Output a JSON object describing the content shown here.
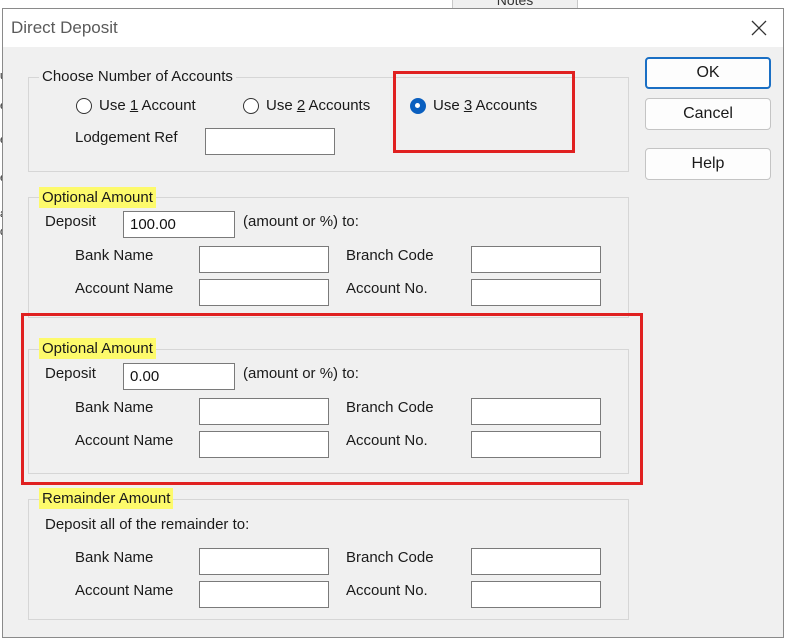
{
  "background": {
    "tab_label": "Notes",
    "left_edge_chars": [
      "u",
      "e",
      "e",
      "e",
      "a",
      "d"
    ]
  },
  "dialog": {
    "title": "Direct Deposit",
    "close_glyph": "✕"
  },
  "buttons": {
    "ok": "OK",
    "cancel": "Cancel",
    "help": "Help"
  },
  "accounts_group": {
    "title": "Choose Number of Accounts",
    "options": [
      {
        "pre": "Use ",
        "key": "1",
        "post": " Account",
        "selected": false
      },
      {
        "pre": "Use ",
        "key": "2",
        "post": " Accounts",
        "selected": false
      },
      {
        "pre": "Use ",
        "key": "3",
        "post": " Accounts",
        "selected": true
      }
    ],
    "lodgement_label": "Lodgement Ref",
    "lodgement_value": ""
  },
  "optional_1": {
    "title": "Optional Amount",
    "deposit_label": "Deposit",
    "deposit_value": "100.00",
    "suffix": "(amount or %) to:",
    "bank_name_label": "Bank Name",
    "bank_name_value": "",
    "branch_code_label": "Branch Code",
    "branch_code_value": "",
    "account_name_label": "Account Name",
    "account_name_value": "",
    "account_no_label": "Account No.",
    "account_no_value": ""
  },
  "optional_2": {
    "title": "Optional Amount",
    "deposit_label": "Deposit",
    "deposit_value": "0.00",
    "suffix": "(amount or %) to:",
    "bank_name_label": "Bank Name",
    "bank_name_value": "",
    "branch_code_label": "Branch Code",
    "branch_code_value": "",
    "account_name_label": "Account Name",
    "account_name_value": "",
    "account_no_label": "Account No.",
    "account_no_value": ""
  },
  "remainder": {
    "title": "Remainder Amount",
    "subtitle": "Deposit all of the remainder to:",
    "bank_name_label": "Bank Name",
    "bank_name_value": "",
    "branch_code_label": "Branch Code",
    "branch_code_value": "",
    "account_name_label": "Account Name",
    "account_name_value": "",
    "account_no_label": "Account No.",
    "account_no_value": ""
  },
  "colors": {
    "highlight": "#fdfa6b",
    "annotation_red": "#e02020",
    "radio_selected": "#0a5fbf"
  }
}
